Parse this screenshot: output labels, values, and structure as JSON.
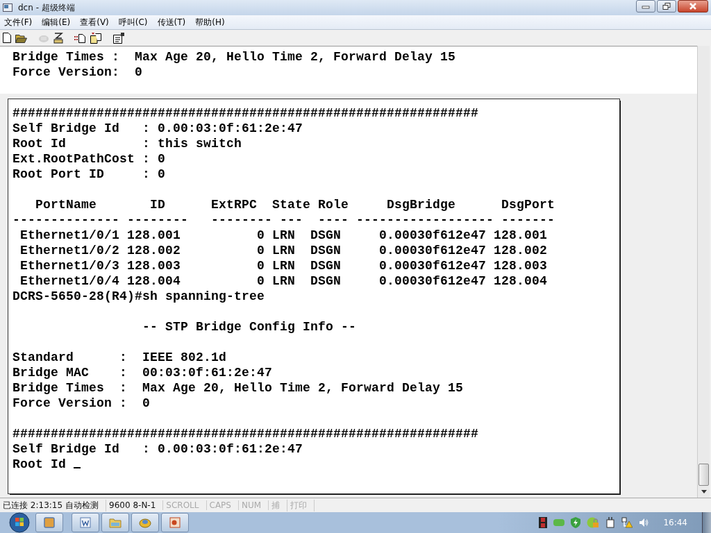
{
  "window": {
    "title": "dcn - 超级终端"
  },
  "menu": [
    "文件(F)",
    "编辑(E)",
    "查看(V)",
    "呼叫(C)",
    "传送(T)",
    "帮助(H)"
  ],
  "toolbar": [
    {
      "kind": "new",
      "disabled": false
    },
    {
      "kind": "open",
      "disabled": false
    },
    {
      "kind": "call",
      "disabled": true
    },
    {
      "kind": "hangup",
      "disabled": false
    },
    {
      "kind": "send",
      "disabled": false
    },
    {
      "kind": "receive",
      "disabled": false
    },
    {
      "kind": "properties",
      "disabled": false
    }
  ],
  "terminal": {
    "lines": [
      "Bridge Times :  Max Age 20, Hello Time 2, Forward Delay 15",
      "Force Version:  0"
    ]
  },
  "inner_panel": {
    "blocks": [
      [
        "#############################################################",
        "Self Bridge Id   : 0.00:03:0f:61:2e:47",
        "Root Id          : this switch",
        "Ext.RootPathCost : 0",
        "Root Port ID     : 0"
      ],
      [
        "   PortName       ID      ExtRPC  State Role     DsgBridge      DsgPort",
        "-------------- --------   -------- ---  ---- ------------------ -------",
        " Ethernet1/0/1 128.001          0 LRN  DSGN     0.00030f612e47 128.001",
        " Ethernet1/0/2 128.002          0 LRN  DSGN     0.00030f612e47 128.002",
        " Ethernet1/0/3 128.003          0 LRN  DSGN     0.00030f612e47 128.003",
        " Ethernet1/0/4 128.004          0 LRN  DSGN     0.00030f612e47 128.004",
        "DCRS-5650-28(R4)#sh spanning-tree"
      ],
      [
        "                 -- STP Bridge Config Info --"
      ],
      [
        "Standard      :  IEEE 802.1d",
        "Bridge MAC    :  00:03:0f:61:2e:47",
        "Bridge Times  :  Max Age 20, Hello Time 2, Forward Delay 15",
        "Force Version :  0"
      ],
      [
        "#############################################################",
        "Self Bridge Id   : 0.00:03:0f:61:2e:47",
        "Root Id "
      ]
    ],
    "cursor": true
  },
  "status_bar": [
    {
      "text": "已连接 2:13:15",
      "active": true
    },
    {
      "text": "自动检测",
      "active": true
    },
    {
      "text": "9600 8-N-1",
      "active": true
    },
    {
      "text": "SCROLL",
      "active": false
    },
    {
      "text": "CAPS",
      "active": false
    },
    {
      "text": "NUM",
      "active": false
    },
    {
      "text": "捕",
      "active": false
    },
    {
      "text": "打印",
      "active": false
    }
  ],
  "taskbar": {
    "buttons": [
      {
        "kind": "window"
      },
      {
        "kind": "word"
      },
      {
        "kind": "folder"
      },
      {
        "kind": "app"
      },
      {
        "kind": "presentation"
      }
    ],
    "clock": "16:44"
  }
}
